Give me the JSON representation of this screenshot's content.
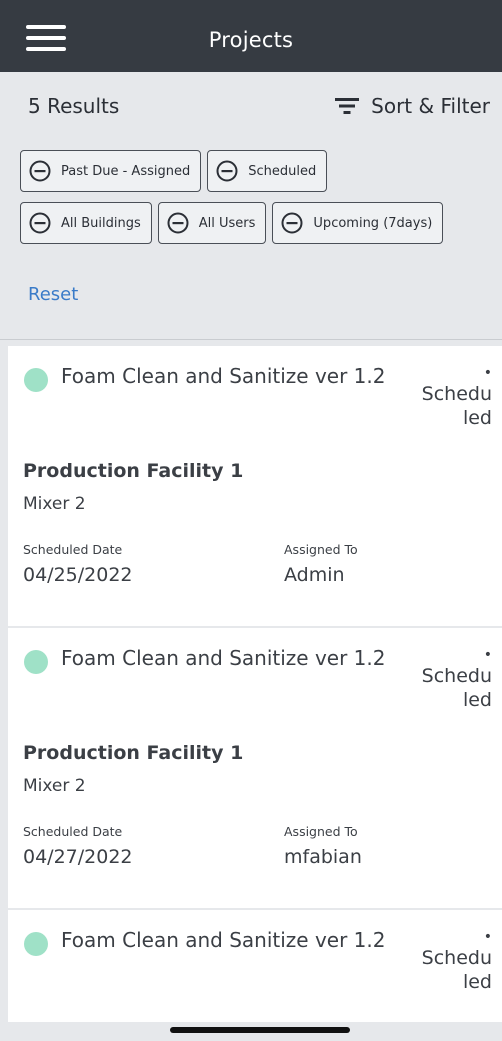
{
  "header": {
    "title": "Projects",
    "menu_icon": "hamburger-menu-icon"
  },
  "filters": {
    "results_count": "5 Results",
    "sort_filter_label": "Sort & Filter",
    "chips": [
      {
        "label": "Past Due - Assigned"
      },
      {
        "label": "Scheduled"
      },
      {
        "label": "All Buildings"
      },
      {
        "label": "All Users"
      },
      {
        "label": "Upcoming (7days)"
      }
    ],
    "reset_label": "Reset"
  },
  "projects": [
    {
      "task": "Foam Clean and Sanitize ver 1.2",
      "status_bullet": "•",
      "status": "Scheduled",
      "facility": "Production Facility 1",
      "equipment": "Mixer 2",
      "scheduled_label": "Scheduled Date",
      "scheduled_date": "04/25/2022",
      "assigned_label": "Assigned To",
      "assigned_to": "Admin"
    },
    {
      "task": "Foam Clean and Sanitize ver 1.2",
      "status_bullet": "•",
      "status": "Scheduled",
      "facility": "Production Facility 1",
      "equipment": "Mixer 2",
      "scheduled_label": "Scheduled Date",
      "scheduled_date": "04/27/2022",
      "assigned_label": "Assigned To",
      "assigned_to": "mfabian"
    },
    {
      "task": "Foam Clean and Sanitize ver 1.2",
      "status_bullet": "•",
      "status": "Scheduled"
    }
  ],
  "colors": {
    "header_bg": "#363b42",
    "panel_bg": "#e6e8eb",
    "status_dot": "#9fe1c7",
    "link": "#3a7bc8"
  }
}
